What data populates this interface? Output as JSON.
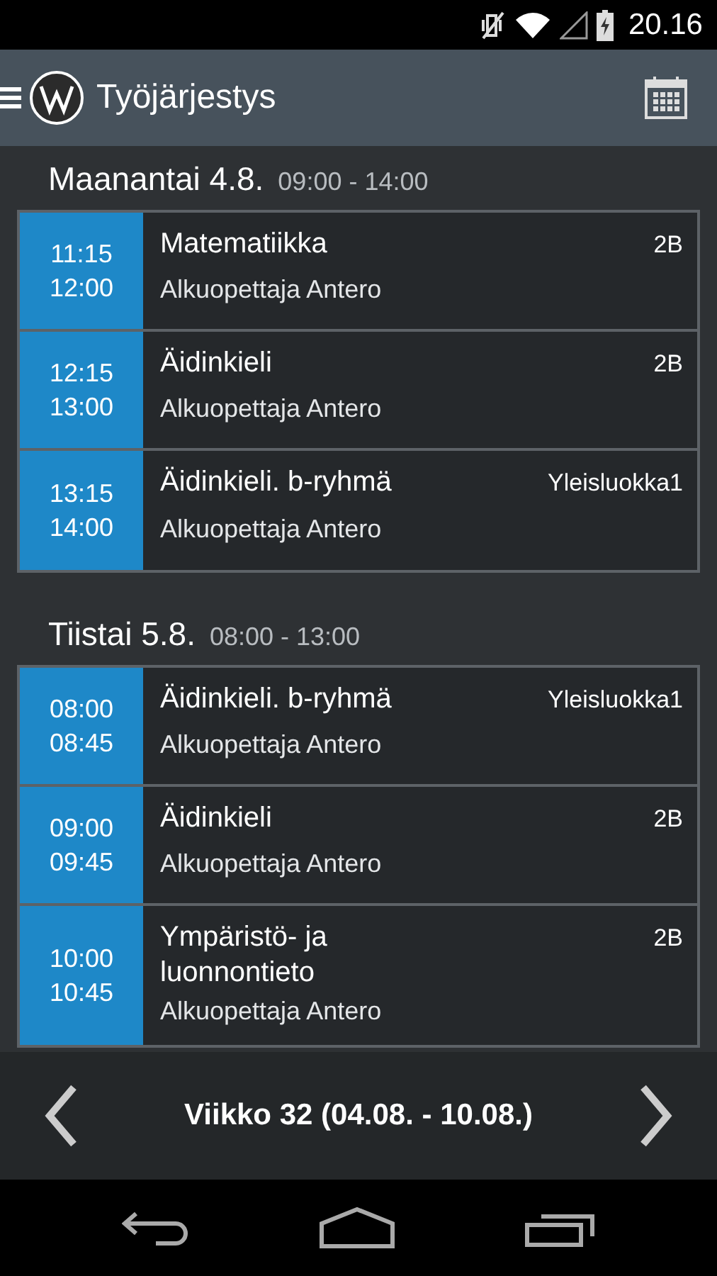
{
  "status_bar": {
    "time": "20.16"
  },
  "app_bar": {
    "title": "Työjärjestys"
  },
  "days": [
    {
      "day": "Maanantai 4.8.",
      "hours": "09:00 - 14:00",
      "lessons": [
        {
          "start": "11:15",
          "end": "12:00",
          "subject": "Matematiikka",
          "teacher": "Alkuopettaja Antero",
          "room": "2B"
        },
        {
          "start": "12:15",
          "end": "13:00",
          "subject": "Äidinkieli",
          "teacher": "Alkuopettaja Antero",
          "room": "2B"
        },
        {
          "start": "13:15",
          "end": "14:00",
          "subject": "Äidinkieli. b-ryhmä",
          "teacher": "Alkuopettaja Antero",
          "room": "Yleisluokka1"
        }
      ]
    },
    {
      "day": "Tiistai 5.8.",
      "hours": "08:00 - 13:00",
      "lessons": [
        {
          "start": "08:00",
          "end": "08:45",
          "subject": "Äidinkieli. b-ryhmä",
          "teacher": "Alkuopettaja Antero",
          "room": "Yleisluokka1"
        },
        {
          "start": "09:00",
          "end": "09:45",
          "subject": "Äidinkieli",
          "teacher": "Alkuopettaja Antero",
          "room": "2B"
        },
        {
          "start": "10:00",
          "end": "10:45",
          "subject": "Ympäristö- ja luonnontieto",
          "teacher": "Alkuopettaja Antero",
          "room": "2B"
        }
      ]
    }
  ],
  "week_bar": {
    "label": "Viikko 32 (04.08. - 10.08.)"
  }
}
